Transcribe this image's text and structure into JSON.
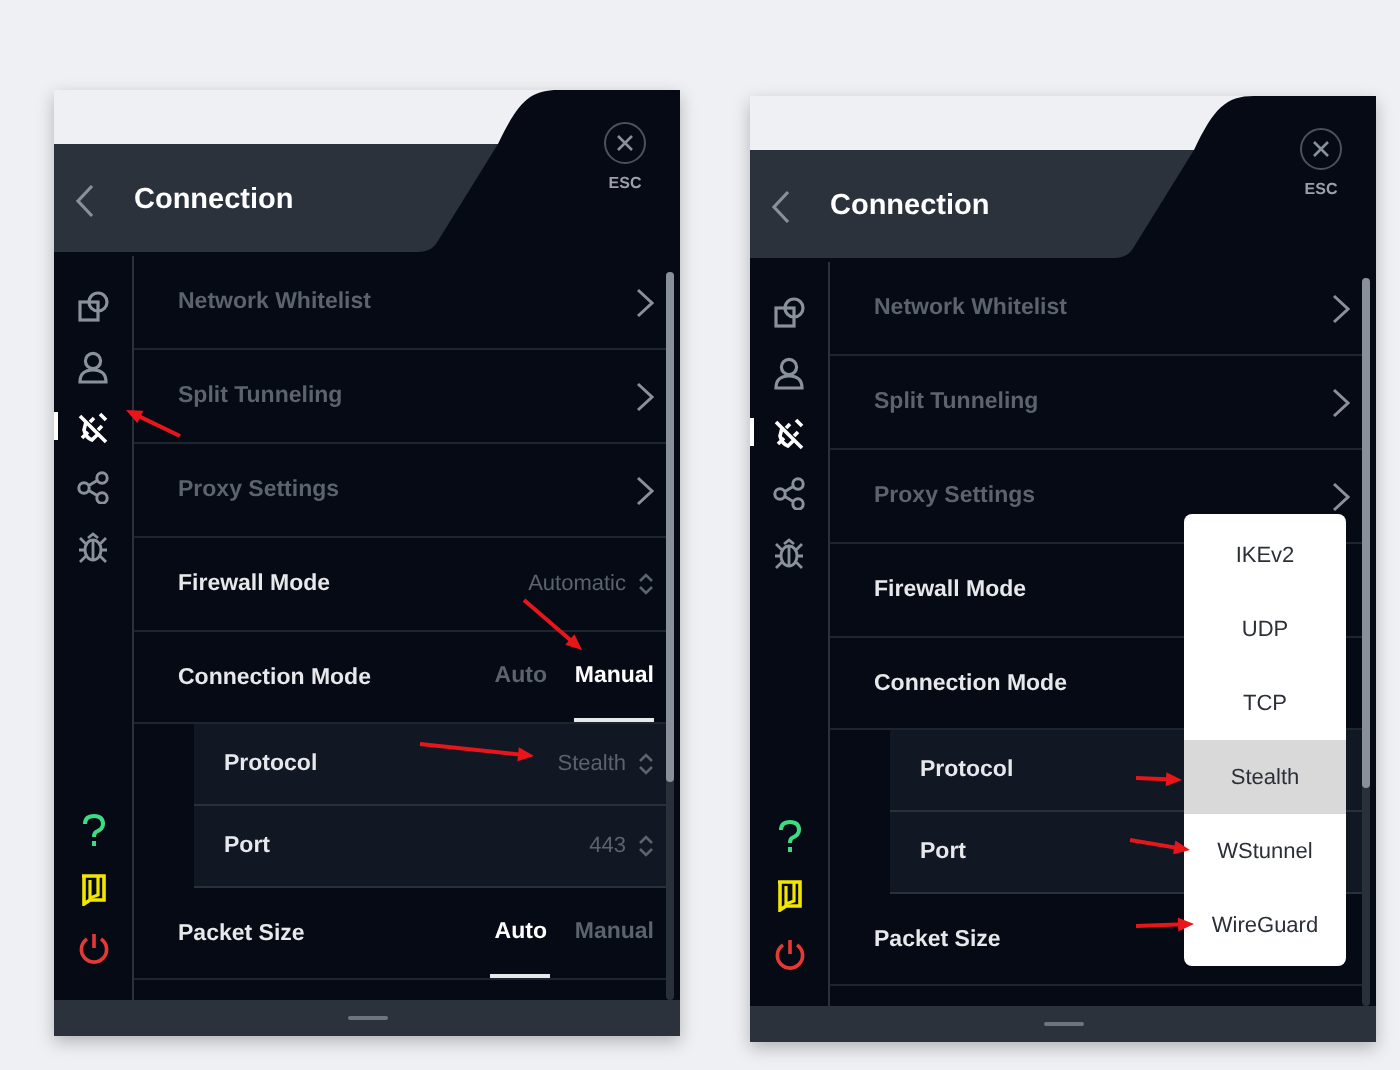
{
  "panels": [
    {
      "header": {
        "title": "Connection",
        "close_label": "ESC"
      },
      "sidebar": {
        "items": [
          {
            "selected": false
          },
          {
            "selected": false
          },
          {
            "selected": true
          },
          {
            "selected": false
          },
          {
            "selected": false
          }
        ]
      },
      "rows": [
        {
          "kind": "link",
          "label": "Network Whitelist"
        },
        {
          "kind": "link",
          "label": "Split Tunneling"
        },
        {
          "kind": "link",
          "label": "Proxy Settings"
        },
        {
          "kind": "select",
          "label": "Firewall Mode",
          "value": "Automatic"
        },
        {
          "kind": "toggle",
          "label": "Connection Mode",
          "options": [
            {
              "label": "Auto",
              "selected": false
            },
            {
              "label": "Manual",
              "selected": true
            }
          ]
        },
        {
          "kind": "subselect",
          "label": "Protocol",
          "value": "Stealth"
        },
        {
          "kind": "subselect",
          "label": "Port",
          "value": "443"
        },
        {
          "kind": "toggle",
          "label": "Packet Size",
          "options": [
            {
              "label": "Auto",
              "selected": true
            },
            {
              "label": "Manual",
              "selected": false
            }
          ]
        }
      ]
    },
    {
      "header": {
        "title": "Connection",
        "close_label": "ESC"
      },
      "sidebar": {
        "items": [
          {
            "selected": false
          },
          {
            "selected": false
          },
          {
            "selected": true
          },
          {
            "selected": false
          },
          {
            "selected": false
          }
        ]
      },
      "rows": [
        {
          "kind": "link",
          "label": "Network Whitelist"
        },
        {
          "kind": "link",
          "label": "Split Tunneling"
        },
        {
          "kind": "link",
          "label": "Proxy Settings"
        },
        {
          "kind": "select",
          "label": "Firewall Mode"
        },
        {
          "kind": "toggle",
          "label": "Connection Mode"
        },
        {
          "kind": "subselect",
          "label": "Protocol"
        },
        {
          "kind": "subselect",
          "label": "Port"
        },
        {
          "kind": "toggle",
          "label": "Packet Size"
        }
      ],
      "dropdown": {
        "options": [
          {
            "label": "IKEv2",
            "selected": false
          },
          {
            "label": "UDP",
            "selected": false
          },
          {
            "label": "TCP",
            "selected": false
          },
          {
            "label": "Stealth",
            "selected": true
          },
          {
            "label": "WStunnel",
            "selected": false
          },
          {
            "label": "WireGuard",
            "selected": false
          }
        ]
      }
    }
  ]
}
